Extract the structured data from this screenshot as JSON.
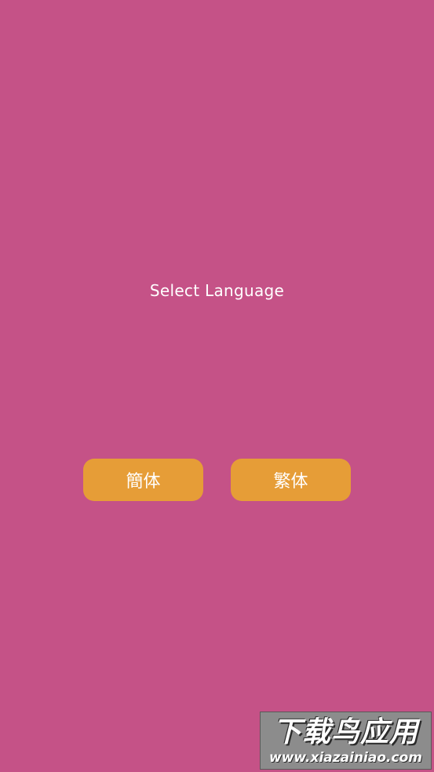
{
  "screen": {
    "background_color": "#c55287",
    "prompt": "Select Language"
  },
  "buttons": {
    "simplified_label": "簡体",
    "traditional_label": "繁体",
    "color": "#e69d37"
  },
  "watermark": {
    "title": "下载鸟应用",
    "url": "www.xiazainiao.com"
  }
}
